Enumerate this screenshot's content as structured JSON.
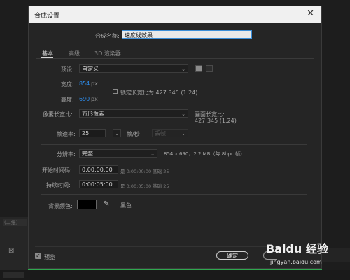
{
  "dialog": {
    "title": "合成设置",
    "name_label": "合成名称:",
    "name_value": "速度线效果"
  },
  "tabs": [
    "基本",
    "高级",
    "3D 渲染器"
  ],
  "basic": {
    "preset_label": "预设:",
    "preset_value": "自定义",
    "width_label": "宽度:",
    "width_value": "854",
    "width_unit": "px",
    "height_label": "高度:",
    "height_value": "690",
    "height_unit": "px",
    "lock_aspect_label": "锁定长宽比为 427:345 (1.24)",
    "lock_aspect_checked": false,
    "pixel_aspect_label": "像素长宽比:",
    "pixel_aspect_value": "方形像素",
    "frame_aspect_label": "画面长宽比:",
    "frame_aspect_value": "427:345 (1.24)",
    "frame_rate_label": "帧速率:",
    "frame_rate_value": "25",
    "frame_rate_unit": "帧/秒",
    "drop_frame_value": "丢帧",
    "resolution_label": "分辨率:",
    "resolution_value": "完整",
    "resolution_info": "854 x 690，2.2 MB（每 8bpc 帧）",
    "start_timecode_label": "开始时间码:",
    "start_timecode_value": "0:00:00:00",
    "start_timecode_info": "是 0:00:00:00  基础 25",
    "duration_label": "持续时间:",
    "duration_value": "0:00:05:00",
    "duration_info": "是 0:00:05:00  基础 25",
    "bg_color_label": "背景颜色:",
    "bg_color_name": "黑色",
    "bg_color_hex": "#000000"
  },
  "footer": {
    "preview_label": "预览",
    "preview_checked": true,
    "ok_label": "确定"
  },
  "background": {
    "tab_label": "(二维)",
    "watermark_text": "Baidu 经验",
    "watermark_url": "jingyan.baidu.com"
  },
  "colors": {
    "accent_blue": "#2d8ceb",
    "timeline_green": "#2fa84f",
    "dialog_bg": "#252525"
  }
}
